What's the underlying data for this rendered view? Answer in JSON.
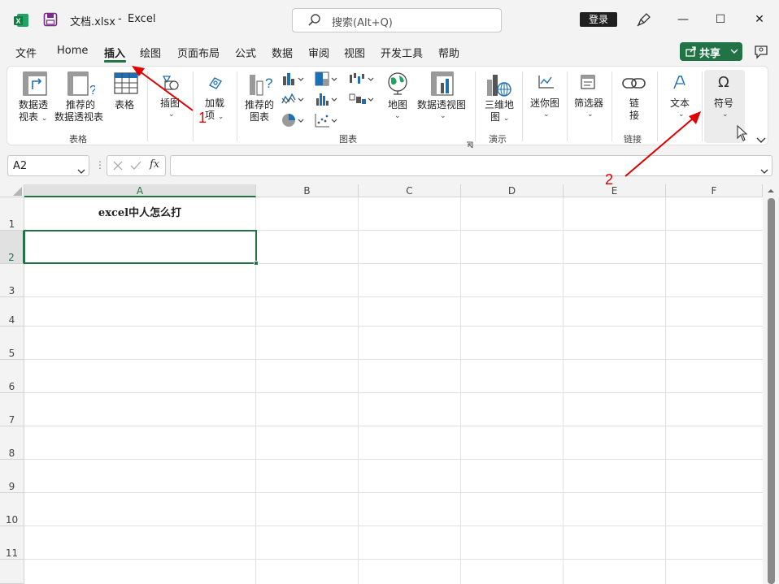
{
  "titlebar": {
    "filename": "文档.xlsx",
    "separator": "-",
    "app_name": "Excel",
    "search_placeholder": "搜索(Alt+Q)",
    "login_label": "登录",
    "minimize": "—",
    "maximize": "☐",
    "close": "✕"
  },
  "menu": {
    "tabs": [
      "文件",
      "Home",
      "插入",
      "绘图",
      "页面布局",
      "公式",
      "数据",
      "审阅",
      "视图",
      "开发工具",
      "帮助"
    ],
    "active_tab": "插入",
    "share_label": "共享"
  },
  "ribbon": {
    "pivot_table": {
      "line1": "数据透",
      "line2": "视表"
    },
    "recommended_pivot": {
      "line1": "推荐的",
      "line2": "数据透视表"
    },
    "table": "表格",
    "group_tables": "表格",
    "illustrations": "插图",
    "addins": {
      "line1": "加载",
      "line2": "项"
    },
    "recommended_charts": {
      "line1": "推荐的",
      "line2": "图表"
    },
    "maps": "地图",
    "pivot_chart": "数据透视图",
    "group_charts": "图表",
    "map3d": {
      "line1": "三维地",
      "line2": "图"
    },
    "group_tours": "演示",
    "sparklines": "迷你图",
    "filters": "筛选器",
    "link": {
      "line1": "链",
      "line2": "接"
    },
    "group_links": "链接",
    "text": "文本",
    "symbols": "符号",
    "omega_icon": "Ω"
  },
  "formula_bar": {
    "name_box": "A2",
    "fx": "fx",
    "formula": ""
  },
  "grid": {
    "columns": [
      "A",
      "B",
      "C",
      "D",
      "E",
      "F"
    ],
    "rows": [
      "1",
      "2",
      "3",
      "4",
      "5",
      "6",
      "7",
      "8",
      "9",
      "10",
      "11"
    ],
    "cell_a1": "excel中人怎么打",
    "selected_cell": "A2"
  },
  "annotations": {
    "label1": "1",
    "label2": "2",
    "arrow_color": "#e00000"
  },
  "colors": {
    "accent": "#217346"
  }
}
